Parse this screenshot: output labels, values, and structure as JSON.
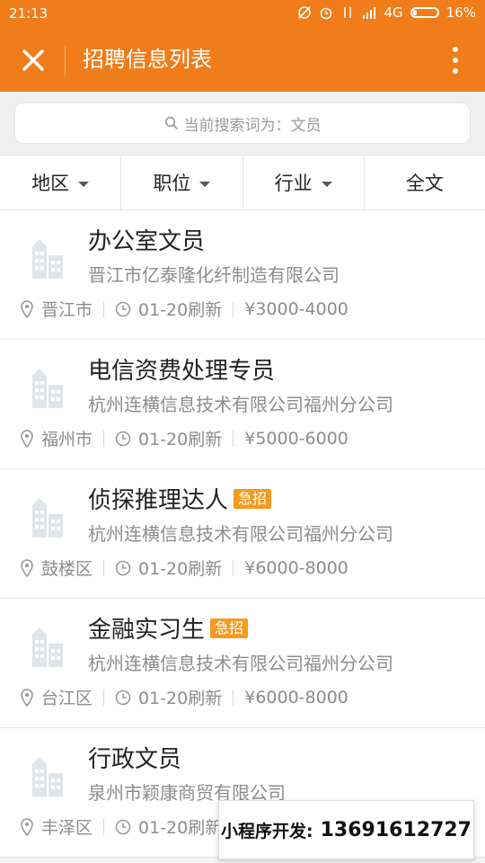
{
  "status": {
    "time": "21:13",
    "network": "4G",
    "battery": "16%"
  },
  "appbar": {
    "title": "招聘信息列表"
  },
  "search": {
    "text": "当前搜索词为：文员"
  },
  "filters": [
    "地区",
    "职位",
    "行业",
    "全文"
  ],
  "jobs": [
    {
      "title": "办公室文员",
      "badge": "",
      "company": "晋江市亿泰隆化纤制造有限公司",
      "location": "晋江市",
      "refresh": "01-20刷新",
      "salary": "¥3000-4000"
    },
    {
      "title": "电信资费处理专员",
      "badge": "",
      "company": "杭州连横信息技术有限公司福州分公司",
      "location": "福州市",
      "refresh": "01-20刷新",
      "salary": "¥5000-6000"
    },
    {
      "title": "侦探推理达人",
      "badge": "急招",
      "company": "杭州连横信息技术有限公司福州分公司",
      "location": "鼓楼区",
      "refresh": "01-20刷新",
      "salary": "¥6000-8000"
    },
    {
      "title": "金融实习生",
      "badge": "急招",
      "company": "杭州连横信息技术有限公司福州分公司",
      "location": "台江区",
      "refresh": "01-20刷新",
      "salary": "¥6000-8000"
    },
    {
      "title": "行政文员",
      "badge": "",
      "company": "泉州市颖康商贸有限公司",
      "location": "丰泽区",
      "refresh": "01-20刷新",
      "salary": ""
    }
  ],
  "promo": {
    "label": "小程序开发:",
    "phone": "13691612727"
  },
  "colors": {
    "accent": "#f07d1a",
    "badge": "#f39a21"
  }
}
